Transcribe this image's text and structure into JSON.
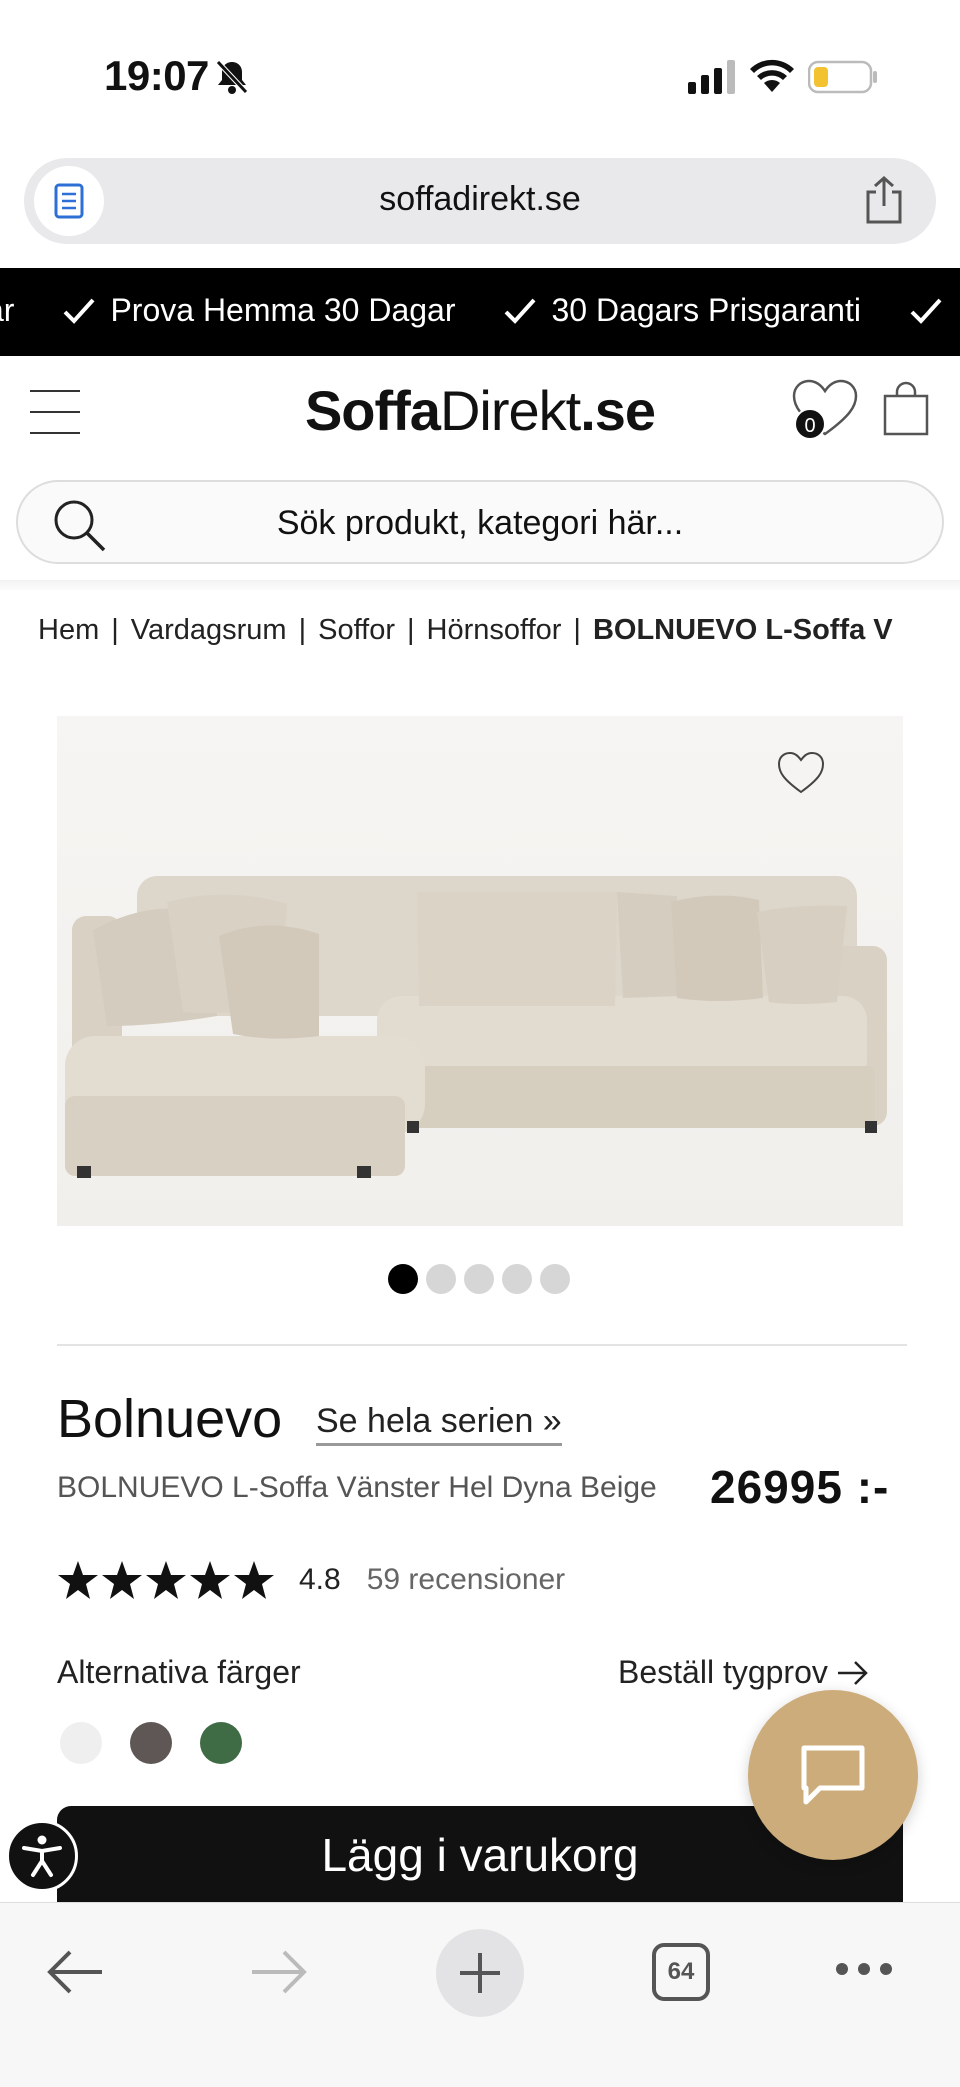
{
  "status_bar": {
    "time": "19:07"
  },
  "browser": {
    "url": "soffadirekt.se",
    "tab_count": "64"
  },
  "promo": {
    "items": [
      "ar",
      "Prova Hemma 30 Dagar",
      "30 Dagars Prisgaranti"
    ]
  },
  "header": {
    "logo_bold": "Soffa",
    "logo_light": "Direkt",
    "logo_suffix": ".se",
    "wishlist_count": "0"
  },
  "search": {
    "placeholder": "Sök produkt, kategori här..."
  },
  "breadcrumb": {
    "items": [
      "Hem",
      "Vardagsrum",
      "Soffor",
      "Hörnsoffor"
    ],
    "current": "BOLNUEVO L-Soffa V",
    "separator": "|"
  },
  "gallery": {
    "image_count": 5,
    "active_index": 0
  },
  "product": {
    "name": "Bolnuevo",
    "series_link": "Se hela serien »",
    "subtitle": "BOLNUEVO L-Soffa Vänster Hel Dyna Beige",
    "price": "26995 :-",
    "rating": "4.8",
    "rating_stars": 5,
    "reviews": "59 recensioner",
    "alt_colors_label": "Alternativa färger",
    "fabric_sample_link": "Beställ tygprov",
    "color_swatches": [
      "#efefef",
      "#5e5756",
      "#3f6b45"
    ],
    "add_to_cart": "Lägg i varukorg"
  },
  "colors": {
    "promo_bg": "#000000",
    "chat_button": "#ccac7a",
    "cart_button": "#111111"
  }
}
